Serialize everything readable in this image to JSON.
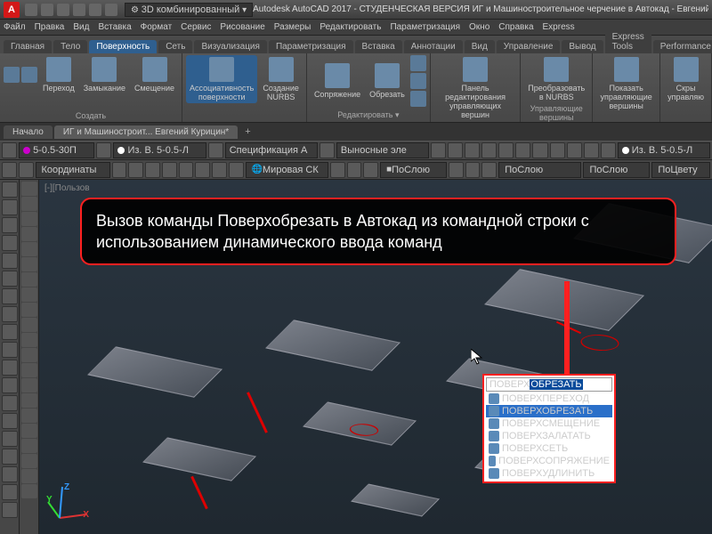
{
  "title": "Autodesk AutoCAD 2017 - СТУДЕНЧЕСКАЯ ВЕРСИЯ   ИГ и Машиностроительное черчение в Автокад - Евгений К",
  "workspace_dd": "3D комбинированный",
  "menus": [
    "Файл",
    "Правка",
    "Вид",
    "Вставка",
    "Формат",
    "Сервис",
    "Рисование",
    "Размеры",
    "Редактировать",
    "Параметризация",
    "Окно",
    "Справка",
    "Express"
  ],
  "ribbon_tabs": [
    "Главная",
    "Тело",
    "Поверхность",
    "Сеть",
    "Визуализация",
    "Параметризация",
    "Вставка",
    "Аннотации",
    "Вид",
    "Управление",
    "Вывод",
    "Express Tools",
    "Performance"
  ],
  "active_tab": "Поверхность",
  "panels": {
    "p1": {
      "items": [
        "Переход",
        "Замыкание",
        "Смещение"
      ],
      "label": "Создать"
    },
    "p2": {
      "items": [
        "Ассоциативность поверхности",
        "Создание NURBS"
      ],
      "label": ""
    },
    "p3": {
      "items": [
        "Сопряжение",
        "Обрезать"
      ],
      "label": "Редактировать ▾"
    },
    "p4": {
      "items": [
        "Панель редактирования управляющих вершин"
      ],
      "label": ""
    },
    "p5": {
      "items": [
        "Преобразовать в NURBS"
      ],
      "label": "Управляющие вершины"
    },
    "p6": {
      "items": [
        "Показать управляющие вершины"
      ],
      "label": ""
    },
    "p7": {
      "items": [
        "Скры управляю"
      ],
      "label": ""
    }
  },
  "doc_tabs": [
    "Начало",
    "ИГ и Машиностроит... Евгений Курицин*"
  ],
  "layers": {
    "dd1": "5-0.5-30П",
    "dd2": "Из. В. 5-0.5-Л",
    "dd3": "Спецификация А",
    "dd4": "Выносные эле",
    "dd5": "Из. В. 5-0.5-Л"
  },
  "props": {
    "coord": "Координаты",
    "ucs": "Мировая СК",
    "layer": "ПоСлою",
    "lt": "ПоСлою",
    "lw": "ПоСлою",
    "col": "ПоЦвету"
  },
  "viewport_label": "[-][Пользов",
  "callout_text": "Вызов команды Поверхобрезать в Автокад из командной строки с использованием динамического ввода команд",
  "dyn_input": {
    "prefix": "ПОВЕРХ",
    "suffix": "ОБРЕЗАТЬ"
  },
  "dyn_items": [
    "ПОВЕРХПЕРЕХОД",
    "ПОВЕРХОБРЕЗАТЬ",
    "ПОВЕРХСМЕЩЕНИЕ",
    "ПОВЕРХЗАЛАТАТЬ",
    "ПОВЕРХСЕТЬ",
    "ПОВЕРХСОПРЯЖЕНИЕ",
    "ПОВЕРХУДЛИНИТЬ"
  ],
  "dyn_selected": 1,
  "ucs_labels": {
    "x": "X",
    "y": "Y",
    "z": "Z"
  }
}
